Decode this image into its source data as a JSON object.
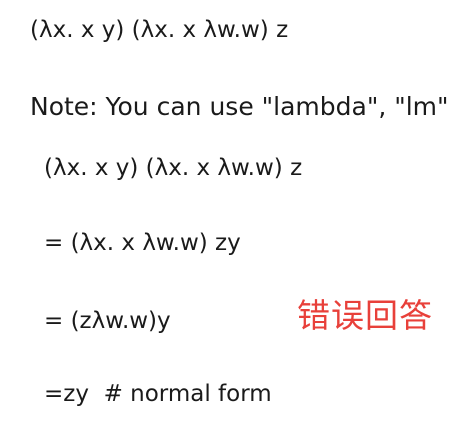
{
  "expression": "(λx. x y) (λx. x λw.w) z",
  "note": "Note: You can use \"lambda\", \"lm\"",
  "steps": [
    "(λx. x y) (λx. x λw.w) z",
    "= (λx. x λw.w) zy",
    "= (zλw.w)y",
    "=zy  # normal form"
  ],
  "annotation": {
    "text": "错误回答",
    "color": "#e8403a"
  }
}
